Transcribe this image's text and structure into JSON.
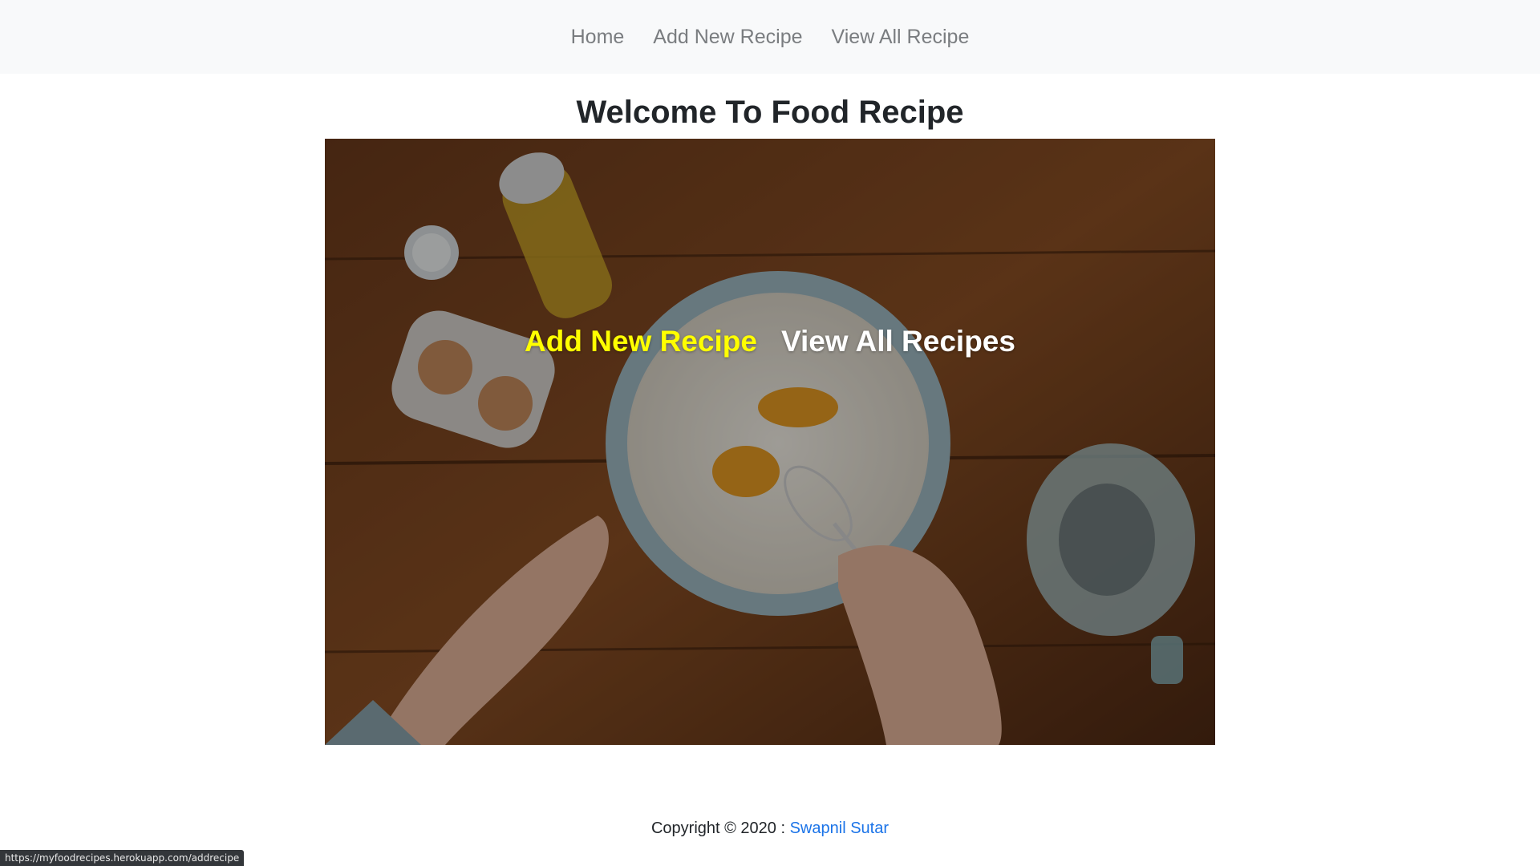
{
  "nav": {
    "home": "Home",
    "add": "Add New Recipe",
    "view": "View All Recipe"
  },
  "page": {
    "title": "Welcome To Food Recipe"
  },
  "hero": {
    "add_label": "Add New Recipe",
    "view_label": "View All Recipes",
    "image_icon": "mixing-bowl-baking-photo"
  },
  "footer": {
    "text": "Copyright © 2020 : ",
    "author": "Swapnil Sutar"
  },
  "status": {
    "url": "https://myfoodrecipes.herokuapp.com/addrecipe"
  },
  "colors": {
    "nav_bg": "#f8f9fa",
    "nav_link": "#7a7d80",
    "hero_add": "#ffff00",
    "hero_view": "#ffffff",
    "footer_link": "#1a73e8"
  }
}
